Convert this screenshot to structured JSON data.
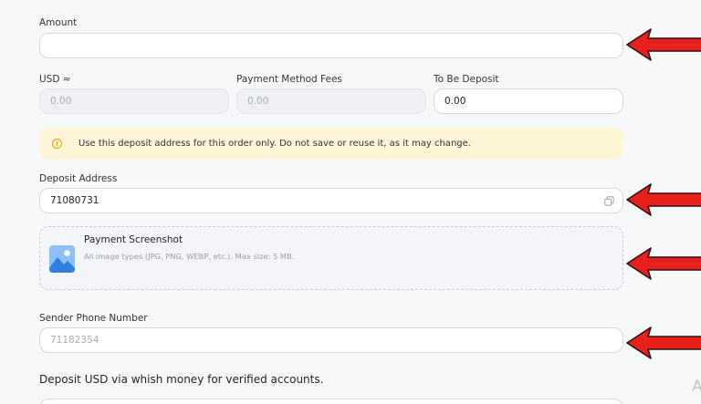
{
  "amount": {
    "label": "Amount",
    "value": ""
  },
  "usd": {
    "label": "USD ≈",
    "value": "0.00"
  },
  "fees": {
    "label": "Payment Method Fees",
    "value": "0.00"
  },
  "to_be_deposit": {
    "label": "To Be Deposit",
    "value": "0.00"
  },
  "notice": {
    "icon": "info-icon",
    "glyph": "!",
    "text": "Use this deposit address for this order only. Do not save or reuse it, as it may change."
  },
  "deposit_address": {
    "label": "Deposit Address",
    "value": "71080731",
    "icon": "copy-icon"
  },
  "payment_screenshot": {
    "title": "Payment Screenshot",
    "hint": "All image types (JPG, PNG, WEBP, etc.). Max size: 5 MB.",
    "icon": "image-icon"
  },
  "sender_phone": {
    "label": "Sender Phone Number",
    "placeholder": "71182354",
    "value": ""
  },
  "info_heading": "Deposit USD via whish money for verified accounts.",
  "edge_glyph": "A",
  "colors": {
    "accent": "#3f8ef0",
    "notice_bg": "#fdf5d6",
    "notice_icon": "#e4a215",
    "arrow": "#e8201b"
  }
}
